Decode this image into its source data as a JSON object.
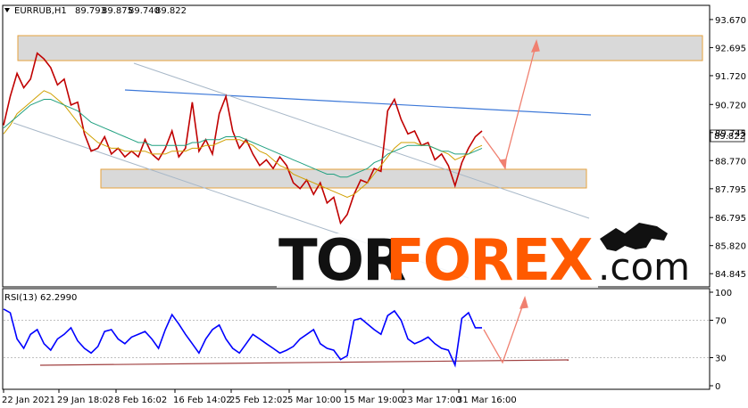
{
  "chart_data": [
    {
      "type": "line",
      "symbol": "EURRUB,H1",
      "ohlc": {
        "open": "89.793",
        "high": "89.875",
        "low": "89.740",
        "close": "89.822"
      },
      "last_price": "89.822",
      "ylim": [
        84.45,
        94.1
      ],
      "y_ticks": [
        "93.670",
        "92.695",
        "91.720",
        "90.720",
        "89.745",
        "88.770",
        "87.795",
        "86.795",
        "85.820",
        "84.845"
      ],
      "x_ticks": [
        "22 Jan 2021",
        "29 Jan 18:02",
        "8 Feb 16:02",
        "16 Feb 14:02",
        "25 Feb 12:02",
        "5 Mar 10:00",
        "15 Mar 19:00",
        "23 Mar 17:00",
        "31 Mar 16:00"
      ],
      "series": [
        {
          "values": [
            90.0,
            91.0,
            91.8,
            91.3,
            91.6,
            92.5,
            92.3,
            92.0,
            91.4,
            91.6,
            90.7,
            90.8,
            89.7,
            89.1,
            89.2,
            89.6,
            89.0,
            89.2,
            88.9,
            89.1,
            88.9,
            89.5,
            89.0,
            88.8,
            89.2,
            89.8,
            88.9,
            89.2,
            90.8,
            89.1,
            89.5,
            89.0,
            90.4,
            91.0,
            89.8,
            89.2,
            89.5,
            89.0,
            88.6,
            88.8,
            88.5,
            88.9,
            88.6,
            88.0,
            87.8,
            88.1,
            87.6,
            88.0,
            87.3,
            87.5,
            86.6,
            86.9,
            87.6,
            88.1,
            88.0,
            88.5,
            88.4,
            90.5,
            90.9,
            90.2,
            89.7,
            89.8,
            89.3,
            89.4,
            88.8,
            89.0,
            88.6,
            87.9,
            88.7,
            89.2,
            89.6,
            89.8
          ],
          "color": "#c00000"
        },
        {
          "values": [
            89.7,
            90.0,
            90.4,
            90.6,
            90.8,
            91.0,
            91.2,
            91.1,
            90.9,
            90.7,
            90.4,
            90.1,
            89.8,
            89.6,
            89.4,
            89.3,
            89.2,
            89.2,
            89.1,
            89.1,
            89.1,
            89.1,
            89.0,
            89.0,
            89.0,
            89.1,
            89.1,
            89.1,
            89.2,
            89.2,
            89.3,
            89.3,
            89.4,
            89.5,
            89.5,
            89.5,
            89.4,
            89.3,
            89.1,
            89.0,
            88.8,
            88.6,
            88.5,
            88.3,
            88.2,
            88.1,
            88.0,
            87.9,
            87.8,
            87.7,
            87.6,
            87.5,
            87.6,
            87.8,
            88.0,
            88.3,
            88.6,
            88.9,
            89.2,
            89.4,
            89.4,
            89.4,
            89.3,
            89.3,
            89.2,
            89.1,
            89.0,
            88.8,
            88.9,
            89.0,
            89.2,
            89.3
          ],
          "color": "#d0a000"
        },
        {
          "values": [
            89.9,
            90.1,
            90.3,
            90.5,
            90.7,
            90.8,
            90.9,
            90.9,
            90.8,
            90.7,
            90.6,
            90.5,
            90.3,
            90.1,
            90.0,
            89.9,
            89.8,
            89.7,
            89.6,
            89.5,
            89.4,
            89.4,
            89.3,
            89.3,
            89.3,
            89.3,
            89.3,
            89.3,
            89.4,
            89.4,
            89.5,
            89.5,
            89.5,
            89.6,
            89.6,
            89.6,
            89.5,
            89.4,
            89.3,
            89.2,
            89.1,
            89.0,
            88.9,
            88.8,
            88.7,
            88.6,
            88.5,
            88.4,
            88.3,
            88.3,
            88.2,
            88.2,
            88.3,
            88.4,
            88.5,
            88.7,
            88.8,
            89.0,
            89.1,
            89.2,
            89.3,
            89.3,
            89.3,
            89.3,
            89.2,
            89.1,
            89.1,
            89.0,
            89.0,
            89.0,
            89.1,
            89.2
          ],
          "color": "#20a080"
        }
      ]
    },
    {
      "type": "line",
      "indicator": "RSI(13) 62.2990",
      "ylim": [
        0,
        100
      ],
      "y_ticks": [
        "100",
        "70",
        "30",
        "0"
      ],
      "levels": [
        70,
        30
      ],
      "series": [
        {
          "values": [
            82,
            78,
            50,
            40,
            55,
            60,
            45,
            38,
            50,
            55,
            62,
            48,
            40,
            35,
            42,
            58,
            60,
            50,
            45,
            52,
            55,
            58,
            50,
            40,
            60,
            76,
            66,
            55,
            45,
            35,
            50,
            60,
            65,
            50,
            40,
            35,
            45,
            55,
            50,
            45,
            40,
            35,
            38,
            42,
            50,
            55,
            60,
            45,
            40,
            38,
            28,
            32,
            70,
            72,
            66,
            60,
            55,
            75,
            80,
            70,
            50,
            45,
            48,
            52,
            45,
            40,
            38,
            22,
            72,
            78,
            62,
            62
          ],
          "color": "#0000ff"
        }
      ]
    }
  ],
  "watermark": {
    "part1": "TOR",
    "part2": "FOREX",
    "part3": ".com"
  }
}
